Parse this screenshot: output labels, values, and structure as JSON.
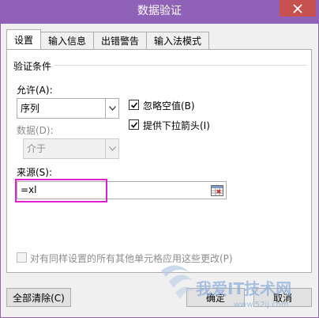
{
  "window": {
    "title": "数据验证"
  },
  "tabs": [
    {
      "label": "设置",
      "active": true
    },
    {
      "label": "输入信息",
      "active": false
    },
    {
      "label": "出错警告",
      "active": false
    },
    {
      "label": "输入法模式",
      "active": false
    }
  ],
  "criteria": {
    "group_title": "验证条件",
    "allow_label": "允许(A):",
    "allow_value": "序列",
    "ignore_blank_label": "忽略空值(B)",
    "ignore_blank_checked": true,
    "dropdown_label": "提供下拉箭头(I)",
    "dropdown_checked": true,
    "data_label": "数据(D):",
    "data_value": "介于",
    "source_label": "来源(S):",
    "source_value": "=xl"
  },
  "apply_all": {
    "label": "对有同样设置的所有其他单元格应用这些更改(P)",
    "checked": false
  },
  "buttons": {
    "clear_all": "全部清除(C)",
    "ok": "确定",
    "cancel": "取消"
  },
  "watermark": {
    "text": "我爱IT技术网",
    "url": "www.52ij.com"
  },
  "colors": {
    "title_bar": "#8f62b8",
    "close_button": "#c75050",
    "highlight": "#e020d0"
  }
}
